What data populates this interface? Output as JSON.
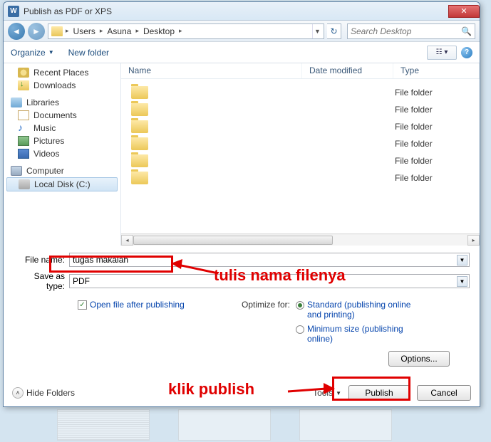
{
  "title": "Publish as PDF or XPS",
  "breadcrumb": {
    "seg1": "Users",
    "seg2": "Asuna",
    "seg3": "Desktop"
  },
  "search": {
    "placeholder": "Search Desktop"
  },
  "toolbar": {
    "organize": "Organize",
    "newfolder": "New folder"
  },
  "columns": {
    "name": "Name",
    "date": "Date modified",
    "type": "Type"
  },
  "sidebar": {
    "recent": "Recent Places",
    "downloads": "Downloads",
    "libraries": "Libraries",
    "documents": "Documents",
    "music": "Music",
    "pictures": "Pictures",
    "videos": "Videos",
    "computer": "Computer",
    "localdisk": "Local Disk (C:)"
  },
  "filetypes": [
    "File folder",
    "File folder",
    "File folder",
    "File folder",
    "File folder",
    "File folder"
  ],
  "form": {
    "filename_label": "File name:",
    "filename_value": "tugas makalah",
    "saveas_label": "Save as type:",
    "saveas_value": "PDF"
  },
  "options": {
    "openafter": "Open file after publishing",
    "optimize_label": "Optimize for:",
    "standard": "Standard (publishing online and printing)",
    "minimum": "Minimum size (publishing online)",
    "options_btn": "Options..."
  },
  "footer": {
    "hidefolders": "Hide Folders",
    "tools": "Tools",
    "publish": "Publish",
    "cancel": "Cancel"
  },
  "annotations": {
    "filename": "tulis nama filenya",
    "publish": "klik publish"
  }
}
